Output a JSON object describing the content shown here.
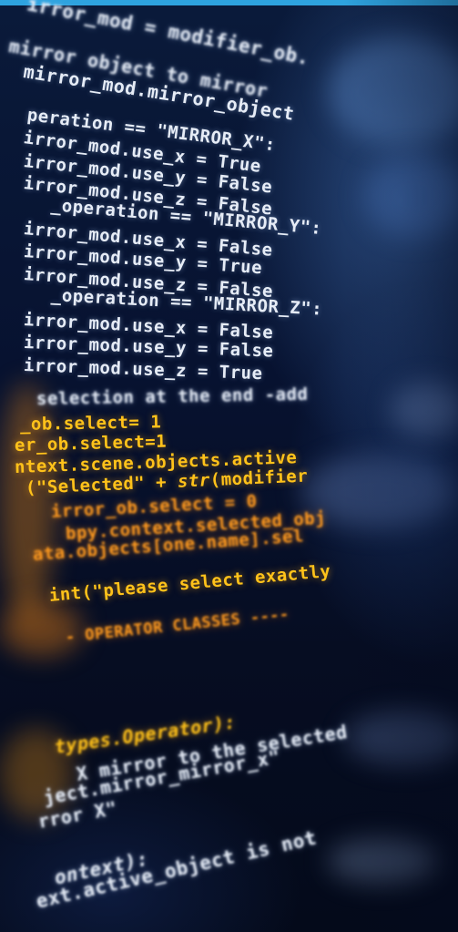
{
  "code_lines": {
    "l01": "irror_mod = modifier_ob.",
    "l02": "mirror object to mirror",
    "l03": "mirror_mod.mirror_object",
    "l04": "peration == \"MIRROR_X\":",
    "l05": "irror_mod.use_x = True",
    "l06": "irror_mod.use_y = False",
    "l07": "irror_mod.use_z = False",
    "l08": "_operation == \"MIRROR_Y\":",
    "l09": "irror_mod.use_x = False",
    "l10": "irror_mod.use_y = True",
    "l11": "irror_mod.use_z = False",
    "l12": "_operation == \"MIRROR_Z\":",
    "l13": "irror_mod.use_x = False",
    "l14": "irror_mod.use_y = False",
    "l15": "irror_mod.use_z = True",
    "l16": "selection at the end -add",
    "l17": "_ob.select= 1",
    "l18": "er_ob.select=1",
    "l19": "ntext.scene.objects.active",
    "l20_a": "(\"Selected\" + ",
    "l20_b": "str",
    "l20_c": "(modifier",
    "l21": "irror_ob.select = 0",
    "l22": "bpy.context.selected_obj",
    "l23": "ata.objects[one.name].sel",
    "l24": "int(\"please select exactly",
    "l25": "- OPERATOR CLASSES ----",
    "l26": "types.Operator):",
    "l27": "X mirror to the selected",
    "l28": "ject.mirror_mirror_x\"",
    "l29": "rror X\"",
    "l30": "ontext):",
    "l31": "ext.active_object is not"
  }
}
